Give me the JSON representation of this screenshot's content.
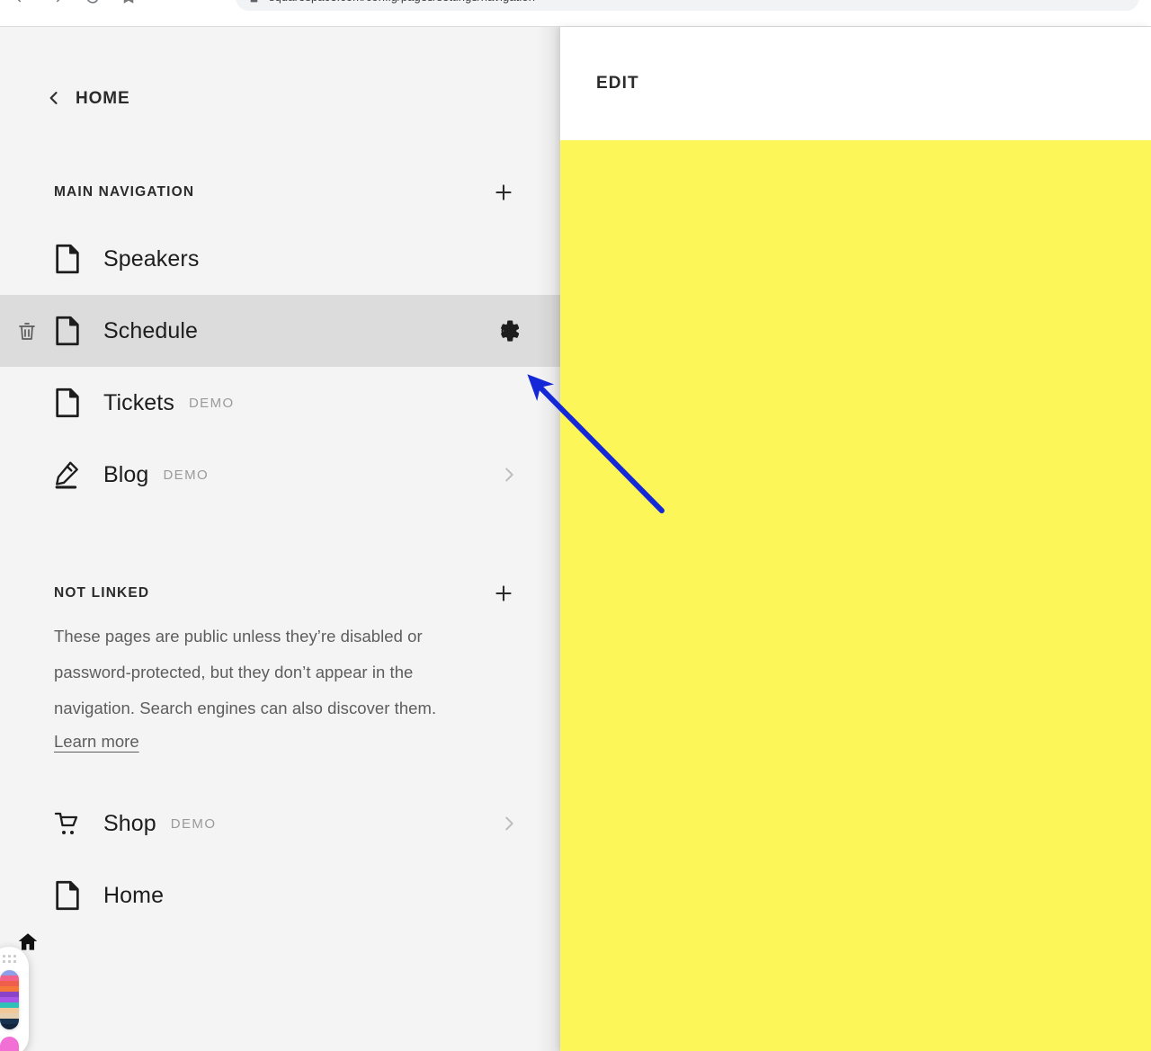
{
  "browser": {
    "url": "squarespace.com/config/pages/settings/navigation",
    "lock_icon": "lock-icon",
    "toolbar_icons": [
      "back-icon",
      "forward-icon",
      "reload-icon",
      "bookmark-icon"
    ]
  },
  "sidebar": {
    "back": {
      "label": "HOME",
      "icon": "chevron-left-icon"
    },
    "sections": [
      {
        "title": "MAIN NAVIGATION",
        "add_icon": "plus-icon",
        "items": [
          {
            "label": "Speakers",
            "icon": "page-icon",
            "badge": "",
            "selected": false,
            "trailing": ""
          },
          {
            "label": "Schedule",
            "icon": "page-icon",
            "badge": "",
            "selected": true,
            "trailing": "gear-icon",
            "delete_icon": "trash-icon"
          },
          {
            "label": "Tickets",
            "icon": "page-icon",
            "badge": "DEMO",
            "selected": false,
            "trailing": ""
          },
          {
            "label": "Blog",
            "icon": "pencil-icon",
            "badge": "DEMO",
            "selected": false,
            "trailing": "chevron-right-icon"
          }
        ]
      },
      {
        "title": "NOT LINKED",
        "add_icon": "plus-icon",
        "description": "These pages are public unless they’re disabled or password-protected, but they don’t appear in the navigation. Search engines can also discover them.",
        "learn_more": "Learn more",
        "items": [
          {
            "label": "Shop",
            "icon": "cart-icon",
            "badge": "DEMO",
            "selected": false,
            "trailing": "chevron-right-icon"
          },
          {
            "label": "Home",
            "icon": "page-icon",
            "badge": "",
            "selected": false,
            "trailing": ""
          }
        ]
      }
    ],
    "home_indicator_icon": "home-icon"
  },
  "preview": {
    "toolbar_label": "EDIT",
    "canvas_color": "#fdf659"
  },
  "annotation": {
    "type": "arrow",
    "color": "#1528d8",
    "points_to": "gear-icon on Schedule row"
  },
  "palette": {
    "grip_icon": "drag-handle-icon",
    "swatches": [
      "#8fa0ea",
      "#f2638b",
      "#ee5e4b",
      "#f5783a",
      "#8b44c9",
      "#a855e8",
      "#2fc0b8",
      "#f0c89a",
      "#e6cfae",
      "#17324f",
      "#12253c"
    ],
    "active_swatch": "#f26fd6"
  },
  "colors": {
    "sidebar_bg": "#f4f4f4",
    "selected_row_bg": "#dcdcdc",
    "accent_yellow": "#fdf659",
    "text_primary": "#1d1d1d",
    "text_muted": "#9a9a9a",
    "annotation_blue": "#1528d8"
  }
}
